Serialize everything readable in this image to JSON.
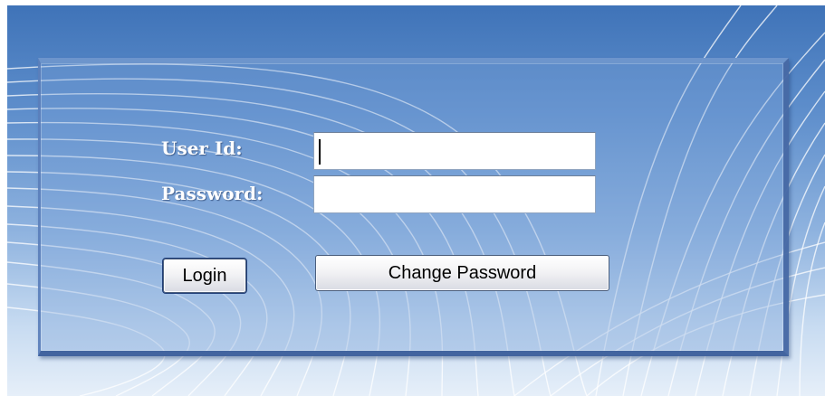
{
  "login_form": {
    "user_id_label": "User Id:",
    "password_label": "Password:",
    "user_id_value": "",
    "password_value": "",
    "login_button_label": "Login",
    "change_password_button_label": "Change Password"
  },
  "colors": {
    "background_top": "#3f73b8",
    "background_bottom": "#e6eff9",
    "label_text": "#ffffff",
    "panel_border": "#4f7bb8"
  }
}
